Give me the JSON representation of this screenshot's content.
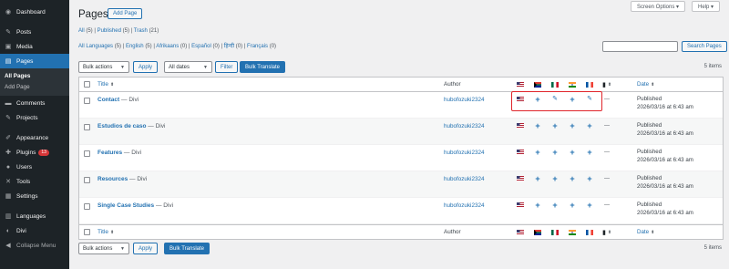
{
  "sidebar": {
    "items": [
      {
        "label": "Dashboard",
        "icon": "dashboard-icon",
        "glyph": "◉"
      },
      {
        "label": "Posts",
        "icon": "pin-icon",
        "glyph": "✎"
      },
      {
        "label": "Media",
        "icon": "media-icon",
        "glyph": "▣"
      },
      {
        "label": "Pages",
        "icon": "pages-icon",
        "glyph": "▤"
      },
      {
        "label": "Comments",
        "icon": "comments-icon",
        "glyph": "▬"
      },
      {
        "label": "Projects",
        "icon": "pin-icon",
        "glyph": "✎"
      },
      {
        "label": "Appearance",
        "icon": "brush-icon",
        "glyph": "✐"
      },
      {
        "label": "Plugins",
        "icon": "plugin-icon",
        "glyph": "✚",
        "badge": "13"
      },
      {
        "label": "Users",
        "icon": "users-icon",
        "glyph": "●"
      },
      {
        "label": "Tools",
        "icon": "tools-icon",
        "glyph": "✕"
      },
      {
        "label": "Settings",
        "icon": "settings-icon",
        "glyph": "▦"
      },
      {
        "label": "Languages",
        "icon": "languages-icon",
        "glyph": "▥"
      },
      {
        "label": "Divi",
        "icon": "divi-icon",
        "glyph": "◐"
      },
      {
        "label": "Collapse Menu",
        "icon": "collapse-icon",
        "glyph": "◀"
      }
    ],
    "submenu": [
      "All Pages",
      "Add Page"
    ]
  },
  "top": {
    "screen_options": "Screen Options ▾",
    "help": "Help ▾"
  },
  "header": {
    "title": "Pages",
    "add_page": "Add Page"
  },
  "views": {
    "all": "All",
    "all_count": "(5)",
    "published": "Published",
    "published_count": "(5)",
    "trash": "Trash",
    "trash_count": "(21)"
  },
  "languages_filter": [
    {
      "label": "All Languages",
      "count": "(5)"
    },
    {
      "label": "English",
      "count": "(5)"
    },
    {
      "label": "Afrikaans",
      "count": "(0)"
    },
    {
      "label": "Español",
      "count": "(0)"
    },
    {
      "label": "हिन्दी",
      "count": "(0)"
    },
    {
      "label": "Français",
      "count": "(0)"
    }
  ],
  "search": {
    "button": "Search Pages",
    "value": ""
  },
  "toolbar": {
    "bulk_actions": "Bulk actions",
    "apply": "Apply",
    "all_dates": "All dates",
    "filter": "Filter",
    "bulk_translate": "Bulk Translate",
    "items": "5 items"
  },
  "table": {
    "columns": {
      "title": "Title",
      "author": "Author",
      "date": "Date"
    },
    "flags": [
      "us",
      "za",
      "mx",
      "in",
      "fr"
    ],
    "rows": [
      {
        "title": "Contact",
        "suffix": " — Divi",
        "author": "hubofozuki2324",
        "status": "Published",
        "date": "2026/03/16 at 6:43 am",
        "langs": [
          "flag",
          "plus",
          "edit",
          "plus",
          "edit"
        ]
      },
      {
        "title": "Estudios de caso",
        "suffix": " — Divi",
        "author": "hubofozuki2324",
        "status": "Published",
        "date": "2026/03/16 at 6:43 am",
        "langs": [
          "flag",
          "plus",
          "plus",
          "plus",
          "plus"
        ]
      },
      {
        "title": "Features",
        "suffix": " — Divi",
        "author": "hubofozuki2324",
        "status": "Published",
        "date": "2026/03/16 at 6:43 am",
        "langs": [
          "flag",
          "plus",
          "plus",
          "plus",
          "plus"
        ]
      },
      {
        "title": "Resources",
        "suffix": " — Divi",
        "author": "hubofozuki2324",
        "status": "Published",
        "date": "2026/03/16 at 6:43 am",
        "langs": [
          "flag",
          "plus",
          "plus",
          "plus",
          "plus"
        ]
      },
      {
        "title": "Single Case Studies",
        "suffix": " — Divi",
        "author": "hubofozuki2324",
        "status": "Published",
        "date": "2026/03/16 at 6:43 am",
        "langs": [
          "flag",
          "plus",
          "plus",
          "plus",
          "plus"
        ]
      }
    ],
    "no_comments": "—"
  },
  "colors": {
    "accent": "#2271b1",
    "sidebar": "#1d2327",
    "highlight": "#e0252b",
    "badge": "#d63638"
  }
}
